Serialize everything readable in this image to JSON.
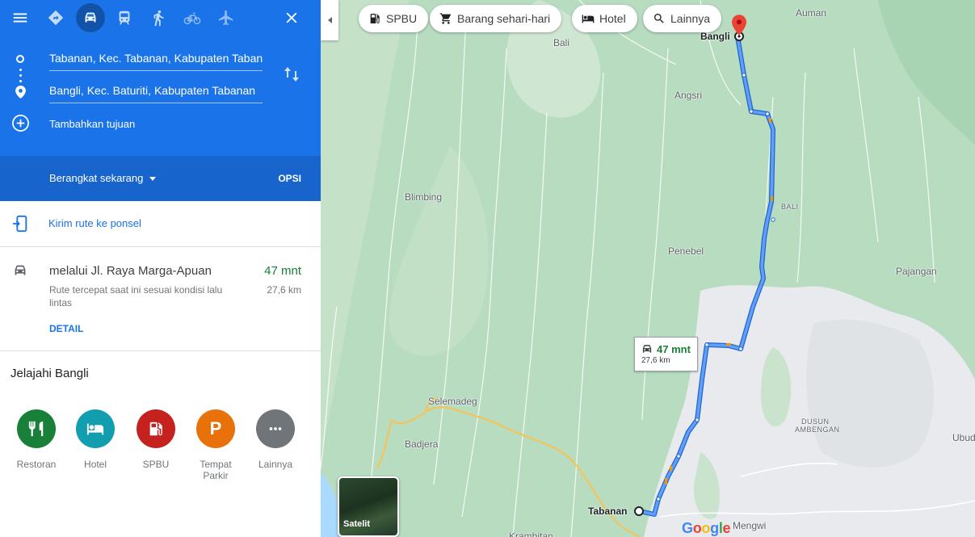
{
  "travel_modes": [
    {
      "name": "route-icon",
      "label": "Terbaik"
    },
    {
      "name": "car-icon",
      "label": "Mobil"
    },
    {
      "name": "transit-icon",
      "label": "Transportasi umum"
    },
    {
      "name": "walk-icon",
      "label": "Jalan kaki"
    },
    {
      "name": "bicycle-icon",
      "label": "Bersepeda"
    },
    {
      "name": "flight-icon",
      "label": "Penerbangan"
    }
  ],
  "directions": {
    "origin": "Tabanan, Kec. Tabanan, Kabupaten Tabanan",
    "destination": "Bangli, Kec. Baturiti, Kabupaten Tabanan",
    "add_destination": "Tambahkan tujuan",
    "depart_label": "Berangkat sekarang",
    "options_label": "OPSI"
  },
  "send_to_phone": "Kirim rute ke ponsel",
  "route": {
    "via": "melalui Jl. Raya Marga-Apuan",
    "duration": "47 mnt",
    "distance": "27,6 km",
    "description": "Rute tercepat saat ini sesuai kondisi lalu lintas",
    "details_label": "DETAIL"
  },
  "explore": {
    "title": "Jelajahi Bangli",
    "items": [
      {
        "label": "Restoran",
        "color": "#188038",
        "icon": "restaurant-icon"
      },
      {
        "label": "Hotel",
        "color": "#129eaf",
        "icon": "hotel-icon"
      },
      {
        "label": "SPBU",
        "color": "#c5221f",
        "icon": "gas-station-icon"
      },
      {
        "label": "Tempat Parkir",
        "color": "#e8710a",
        "icon": "parking-icon"
      },
      {
        "label": "Lainnya",
        "color": "#70757a",
        "icon": "more-icon"
      }
    ]
  },
  "map": {
    "chips": [
      {
        "label": "SPBU",
        "icon": "gas-station-icon"
      },
      {
        "label": "Barang sehari-hari",
        "icon": "cart-icon"
      },
      {
        "label": "Hotel",
        "icon": "hotel-icon"
      },
      {
        "label": "Lainnya",
        "icon": "search-icon"
      }
    ],
    "places": {
      "bali_top": "Bali",
      "bangli": "Bangli",
      "auman": "Auman",
      "angsri": "Angsri",
      "blimbing": "Blimbing",
      "bali_region": "BALI",
      "penebel": "Penebel",
      "pajangan": "Pajangan",
      "selemadeg": "Selemadeg",
      "badjera": "Badjera",
      "dusun_ambengan_1": "DUSUN",
      "dusun_ambengan_2": "AMBENGAN",
      "ubud": "Ubud",
      "tabanan": "Tabanan",
      "mengwi": "Mengwi",
      "krambitan": "Krambitan"
    },
    "callout": {
      "duration": "47 mnt",
      "distance": "27,6 km"
    },
    "satellite_label": "Satelit",
    "logo": "Google",
    "colors": {
      "route": "#4285f4",
      "terrain": "#b7dcc0",
      "urban": "#e8eaed",
      "road_major": "#f6c35a"
    }
  }
}
